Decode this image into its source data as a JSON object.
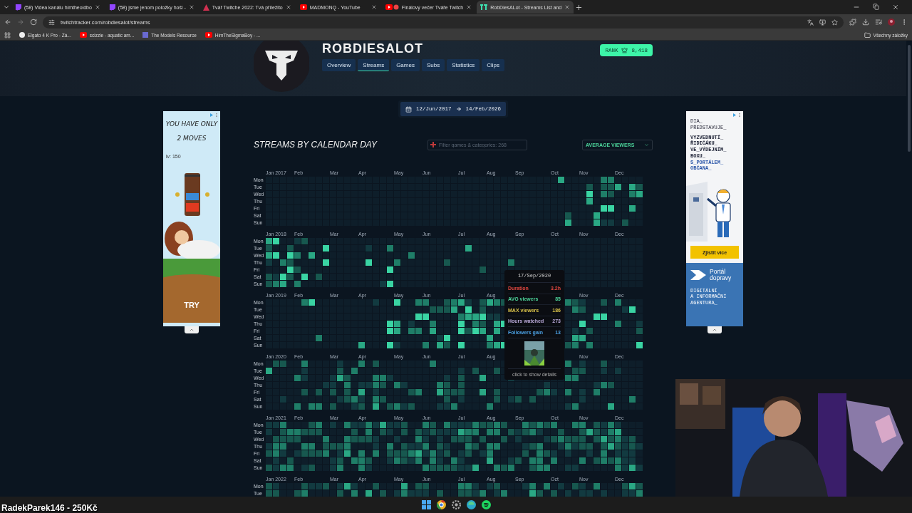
{
  "browser": {
    "tabs": [
      {
        "title": "(58) Videa kanálu himtheoldbo",
        "kind": "twitch",
        "selected": false
      },
      {
        "title": "(58) jsme jenom položky hoši -",
        "kind": "twitch",
        "selected": false
      },
      {
        "title": "Tvář Twitche 2022: Tvá příležito",
        "kind": "alert",
        "selected": false
      },
      {
        "title": "MADMONQ - YouTube",
        "kind": "youtube",
        "selected": false
      },
      {
        "title": "Finálový večer Tváře Twitch",
        "kind": "youtube-live",
        "selected": false
      },
      {
        "title": "RobDiesALot - Streams List and",
        "kind": "tracker",
        "selected": true
      }
    ],
    "url": "twitchtracker.com/robdiesalot/streams",
    "bookmarks": [
      {
        "title": "Elgato 4 K Pro - Zá...",
        "kind": "elgato"
      },
      {
        "title": "scizzie - aquatic am...",
        "kind": "youtube"
      },
      {
        "title": "The Models Resource",
        "kind": "models"
      },
      {
        "title": "HimTheSigmaBoy - ...",
        "kind": "youtube"
      }
    ],
    "all_bookmarks": "Všechny záložky"
  },
  "channel": {
    "name": "ROBDIESALOT",
    "nav": [
      {
        "label": "Overview",
        "selected": false
      },
      {
        "label": "Streams",
        "selected": true
      },
      {
        "label": "Games",
        "selected": false
      },
      {
        "label": "Subs",
        "selected": false
      },
      {
        "label": "Statistics",
        "selected": false
      },
      {
        "label": "Clips",
        "selected": false
      }
    ],
    "rank": {
      "label": "RANK",
      "value": "8,418"
    }
  },
  "date_range": {
    "start": "12/Jun/2017",
    "end": "14/Feb/2026"
  },
  "section": {
    "title": "STREAMS BY CALENDAR DAY",
    "filter_placeholder": "Filter games & categories: 268",
    "metric": "AVERAGE VIEWERS"
  },
  "calendar": {
    "years": [
      {
        "months": [
          "Jan 2017",
          "Feb",
          "Mar",
          "Apr",
          "May",
          "Jun",
          "Jul",
          "Aug",
          "Sep",
          "Oct",
          "Nov",
          "Dec"
        ],
        "days": [
          "Mon",
          "Tue",
          "Wed",
          "Thu",
          "Fri",
          "Sat",
          "Sun"
        ]
      },
      {
        "months": [
          "Jan 2018",
          "Feb",
          "Mar",
          "Apr",
          "May",
          "Jun",
          "Jul",
          "Aug",
          "Sep",
          "Oct",
          "Nov",
          "Dec"
        ],
        "days": [
          "Mon",
          "Tue",
          "Wed",
          "Thu",
          "Fri",
          "Sat",
          "Sun"
        ]
      },
      {
        "months": [
          "Jan 2019",
          "Feb",
          "Mar",
          "Apr",
          "May",
          "Jun",
          "Jul",
          "Aug"
        ],
        "months_right": [
          "Nov",
          "Dec"
        ],
        "days": [
          "Mon",
          "Tue",
          "Wed",
          "Thu",
          "Fri",
          "Sat",
          "Sun"
        ]
      },
      {
        "months": [
          "Jan 2020",
          "Feb",
          "Mar",
          "Apr",
          "May",
          "Jun",
          "Jul",
          "Aug"
        ],
        "months_right": [
          "Nov",
          "Dec"
        ],
        "days": [
          "Mon",
          "Tue",
          "Wed",
          "Thu",
          "Fri",
          "Sat",
          "Sun"
        ]
      },
      {
        "months": [
          "Jan 2021",
          "Feb",
          "Mar",
          "Apr",
          "May",
          "Jun",
          "Jul",
          "Aug",
          "Sep",
          "Oct",
          "Nov",
          "Dec"
        ],
        "days": [
          "Mon",
          "Tue",
          "Wed",
          "Thu",
          "Fri",
          "Sat",
          "Sun"
        ]
      },
      {
        "months": [
          "Jan 2022",
          "Feb",
          "Mar",
          "Apr",
          "May",
          "Jun",
          "Jul",
          "Aug",
          "Sep",
          "Oct",
          "Nov",
          "Dec"
        ],
        "days": [
          "Mon",
          "Tue"
        ]
      }
    ],
    "tooltip": {
      "date": "17/Sep/2020",
      "rows": [
        {
          "label": "Duration",
          "value": "3.2h",
          "color": "#e0473f"
        },
        {
          "label": "AVG viewers",
          "value": "85",
          "color": "#4cd39a"
        },
        {
          "label": "MAX viewers",
          "value": "186",
          "color": "#d9c24a"
        },
        {
          "label": "Hours watched",
          "value": "273",
          "color": "#b9a8d8"
        },
        {
          "label": "Followers gain",
          "value": "13",
          "color": "#4a9ee0"
        }
      ],
      "footer": "click to show details"
    }
  },
  "ad_left": {
    "lines": [
      "YOU HAVE ONLY",
      "2 MOVES"
    ],
    "level": "lv: 150",
    "cta": "TRY"
  },
  "ad_right": {
    "intro": [
      "DIA_",
      "PŘEDSTAVUJE_"
    ],
    "headline": [
      {
        "text": "VYZVEDNUTÍ_",
        "accent": false
      },
      {
        "text": "ŘIDIČÁKU_",
        "accent": false
      },
      {
        "text": "VE_VÝDEJNÍM_",
        "accent": false
      },
      {
        "text": "BOXU_",
        "accent": false
      },
      {
        "text": "S_PORTÁLEM_",
        "accent": true
      },
      {
        "text": "OBČANA_",
        "accent": true
      }
    ],
    "button": "Zjistit více",
    "brand": [
      "Portál",
      "dopravy"
    ],
    "agency": [
      "DIGITÁLNÍ",
      "A INFORMAČNÍ",
      "AGENTURA_"
    ]
  },
  "overlay": {
    "donation": "RadekParek146 - 250Kč"
  }
}
